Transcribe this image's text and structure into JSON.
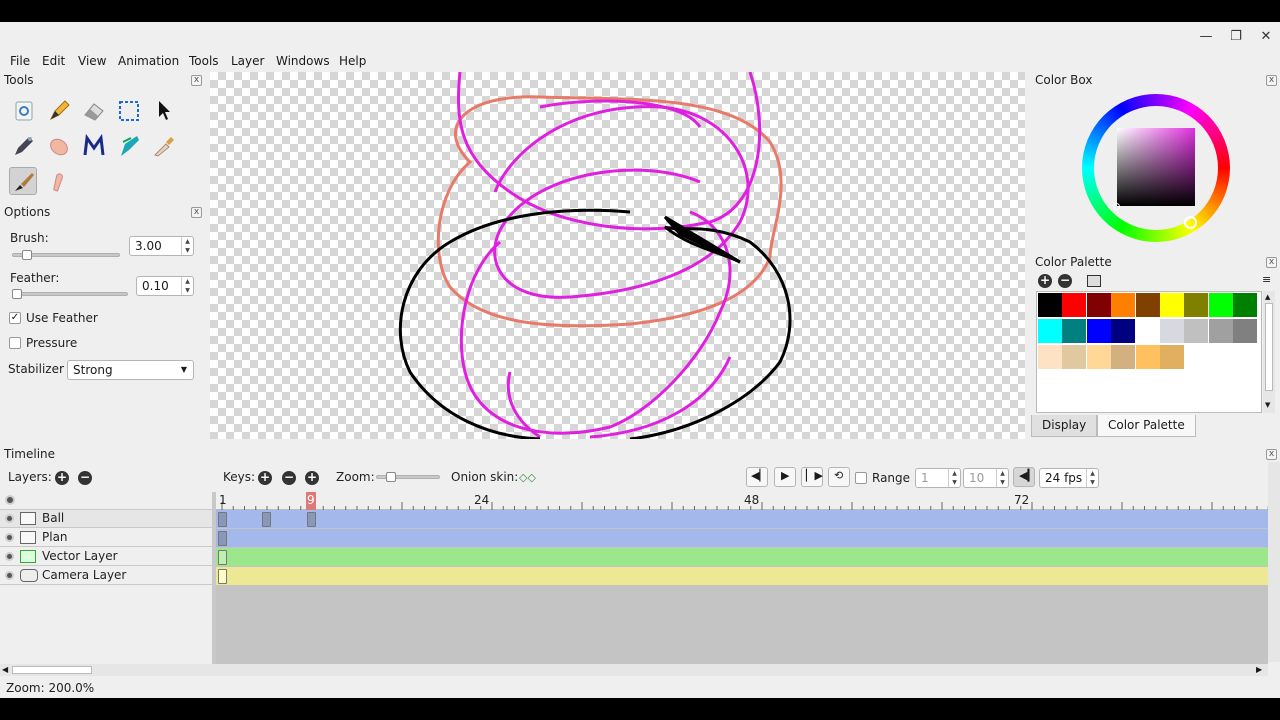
{
  "window": {
    "minimize": "—",
    "maximize": "❐",
    "close": "✕"
  },
  "menu": [
    "File",
    "Edit",
    "View",
    "Animation",
    "Tools",
    "Layer",
    "Windows",
    "Help"
  ],
  "tools_panel": {
    "title": "Tools",
    "close": "x"
  },
  "options_panel": {
    "title": "Options",
    "close": "x",
    "brush_label": "Brush:",
    "brush_value": "3.00",
    "brush_level": 0.1,
    "feather_label": "Feather:",
    "feather_value": "0.10",
    "feather_level": 0.0,
    "use_feather_label": "Use Feather",
    "use_feather_checked": true,
    "pressure_label": "Pressure",
    "pressure_checked": false,
    "stabilizer_label": "Stabilizer",
    "stabilizer_value": "Strong"
  },
  "color_box": {
    "title": "Color Box",
    "selected_color": "#c45bc0"
  },
  "color_palette": {
    "title": "Color Palette",
    "colors": [
      "#000000",
      "#ff0000",
      "#800000",
      "#ff8000",
      "#804000",
      "#ffff00",
      "#808000",
      "#00ff00",
      "#008000",
      "#00ffff",
      "#008080",
      "#0000ff",
      "#000080",
      "#ffffff",
      "#d8d8e0",
      "#c0c0c0",
      "#a0a0a0",
      "#808080",
      "#fde3c4",
      "#e0c8a0",
      "#ffd898",
      "#d2b080",
      "#ffc060",
      "#e0b060"
    ],
    "tab_display": "Display",
    "tab_palette": "Color Palette"
  },
  "timeline": {
    "title": "Timeline",
    "layers_label": "Layers:",
    "keys_label": "Keys:",
    "zoom_label": "Zoom:",
    "onion_label": "Onion skin:",
    "range_label": "Range",
    "range_start": "1",
    "range_end": "10",
    "fps": "24 fps",
    "current_frame": "9",
    "ruler_labels": [
      "1",
      "24",
      "48",
      "72"
    ],
    "layers": [
      {
        "name": "Ball",
        "color": "#a4b8ec"
      },
      {
        "name": "Plan",
        "color": "#a4b8ec"
      },
      {
        "name": "Vector Layer",
        "color": "#9ce68c"
      },
      {
        "name": "Camera Layer",
        "color": "#ece894"
      }
    ]
  },
  "status": {
    "zoom_text": "Zoom: 200.0%"
  }
}
